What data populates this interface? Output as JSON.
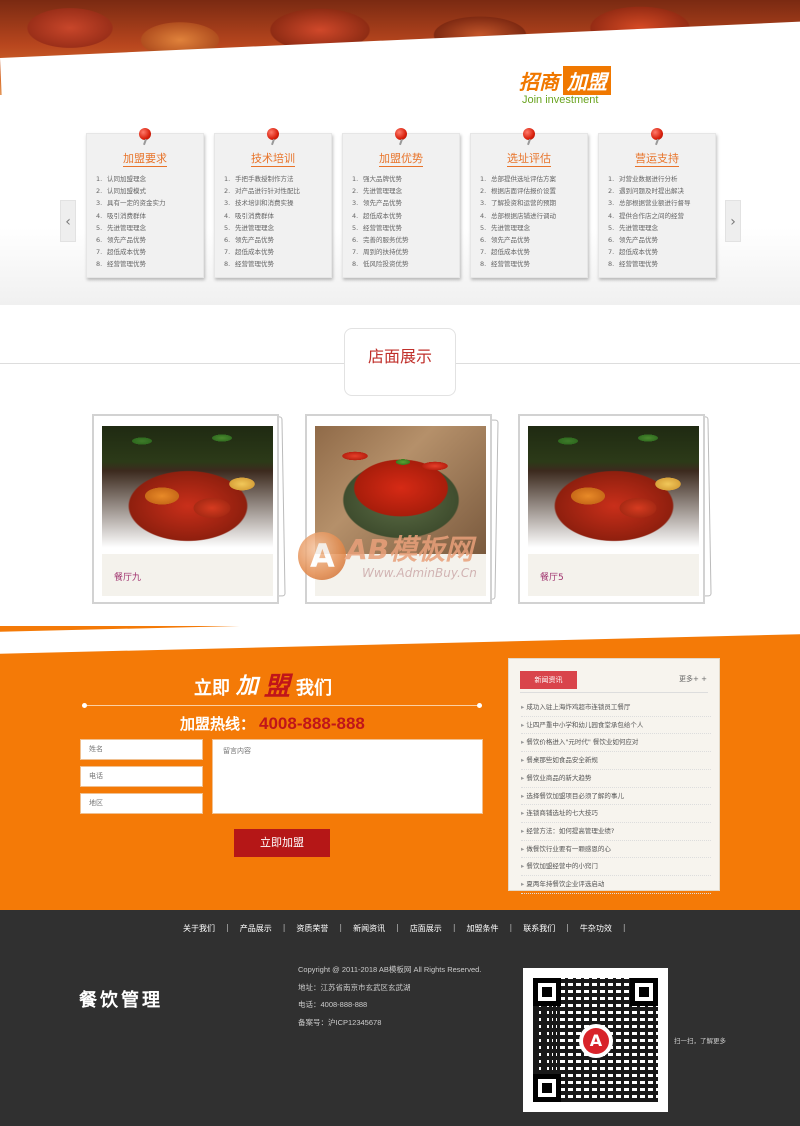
{
  "hero": {
    "title_part1": "招商",
    "title_part2": "加盟",
    "subtitle": "Join investment"
  },
  "carousel": {
    "prev_icon": "chevron-left-icon",
    "next_icon": "chevron-right-icon",
    "prev_glyph": "‹",
    "next_glyph": "›"
  },
  "cards": [
    {
      "title": "加盟要求",
      "items": [
        "1.",
        "认同加盟理念",
        "2.",
        "认同加盟模式",
        "3.",
        "具有一定的资金实力",
        "4.",
        "吸引消费群体",
        "5.",
        "先进管理理念",
        "6.",
        "领先产品优势",
        "7.",
        "超低成本优势",
        "8.",
        "经营管理优势"
      ]
    },
    {
      "title": "技术培训",
      "items": [
        "1.",
        "手把手教授制作方法",
        "2.",
        "对产品进行针对性配比",
        "3.",
        "技术培训和消费实操",
        "4.",
        "吸引消费群体",
        "5.",
        "先进管理理念",
        "6.",
        "领先产品优势",
        "7.",
        "超低成本优势",
        "8.",
        "经营管理优势"
      ]
    },
    {
      "title": "加盟优势",
      "items": [
        "1.",
        "强大品牌优势",
        "2.",
        "先进管理理念",
        "3.",
        "领先产品优势",
        "4.",
        "超低成本优势",
        "5.",
        "经营管理优势",
        "6.",
        "完善的服务优势",
        "7.",
        "周到的扶持优势",
        "8.",
        "低风险投资优势"
      ]
    },
    {
      "title": "选址评估",
      "items": [
        "1.",
        "总部提供选址评估方案",
        "2.",
        "根据店面评估报价设置",
        "3.",
        "了解投资和运营的预期",
        "4.",
        "总部根据店铺进行调动",
        "5.",
        "先进管理理念",
        "6.",
        "领先产品优势",
        "7.",
        "超低成本优势",
        "8.",
        "经营管理优势"
      ]
    },
    {
      "title": "营运支持",
      "items": [
        "1.",
        "对营业数据进行分析",
        "2.",
        "遇到问题及时提出解决",
        "3.",
        "总部根据营业额进行督导",
        "4.",
        "提供合作店之间的经营",
        "5.",
        "先进管理理念",
        "6.",
        "领先产品优势",
        "7.",
        "超低成本优势",
        "8.",
        "经营管理优势"
      ]
    }
  ],
  "store": {
    "title": "店面展示",
    "photos": [
      {
        "label": "餐厅九",
        "image": "crab-dish"
      },
      {
        "label": "",
        "image": "crayfish-dish"
      },
      {
        "label": "餐厅5",
        "image": "crab-dish"
      }
    ],
    "watermark": {
      "letter": "A",
      "brand": "AB模板网",
      "url": "Www.AdminBuy.Cn"
    }
  },
  "cta": {
    "title_a": "立即",
    "title_b": "加",
    "title_c": "盟",
    "title_d": "我们",
    "hotline_label": "加盟热线：",
    "hotline_number": "4008-888-888",
    "name_placeholder": "姓名",
    "phone_placeholder": "电话",
    "region_placeholder": "地区",
    "message_placeholder": "留言内容",
    "submit_label": "立即加盟"
  },
  "news": {
    "tab_label": "新闻资讯",
    "more_label": "更多+ +",
    "items": [
      "成功入驻上海炸鸡超市连锁员工餐厅",
      "让四严重中小学和幼儿园食堂承包给个人",
      "餐饮价格进入\"元时代\" 餐饮业如何应对",
      "餐桌那些如食品安全新规",
      "餐饮业商品的新大趋势",
      "选择餐饮加盟项目必须了解的事儿",
      "连锁商铺选址的七大技巧",
      "经营方法：如何提高管理业绩?",
      "做餐饮行业要有一颗感恩的心",
      "餐饮加盟经营中的小窍门",
      "夏两年持餐饮企业评选启动"
    ]
  },
  "footer": {
    "nav": [
      "关于我们",
      "产品展示",
      "资质荣誉",
      "新闻资讯",
      "店面展示",
      "加盟条件",
      "联系我们",
      "牛杂功效"
    ],
    "separator": "|",
    "logo_text": "餐饮管理",
    "copyright": "Copyright @ 2011-2018 AB模板网 All Rights Reserved.",
    "address": "地址：江苏省南京市玄武区玄武湖",
    "phone": "电话：4008-888-888",
    "icp": "备案号：沪ICP12345678",
    "qr_caption": "扫一扫，了解更多"
  },
  "colors": {
    "accent_orange": "#f47a07",
    "accent_red": "#c0151a",
    "footer_bg": "#303030",
    "join_green": "#6aa421"
  }
}
